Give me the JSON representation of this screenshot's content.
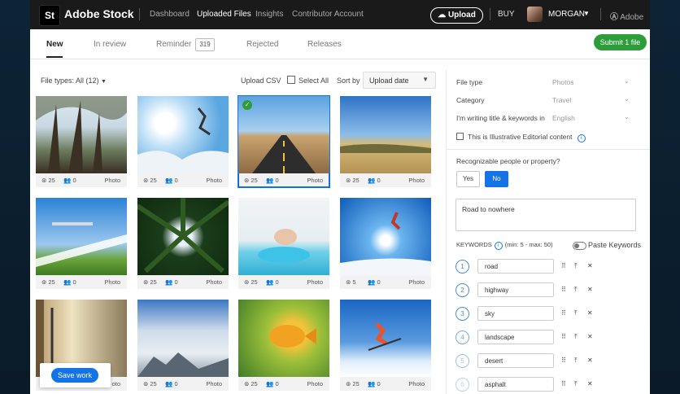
{
  "topbar": {
    "logo": "St",
    "brand": "Adobe Stock",
    "nav": [
      "Dashboard",
      "Uploaded Files",
      "Insights",
      "Contributor Account"
    ],
    "upload": "Upload",
    "buy": "BUY",
    "user": "MORGAN",
    "adobe": "Adobe"
  },
  "tabs": {
    "items": [
      "New",
      "In review",
      "Reminder",
      "Rejected",
      "Releases"
    ],
    "reminder_count": "319",
    "submit": "Submit 1 file"
  },
  "filter": {
    "file_types": "File types: All (12)",
    "upload_csv": "Upload CSV",
    "select_all": "Select All",
    "sort_by": "Sort by",
    "sort_value": "Upload date"
  },
  "cards": [
    {
      "s": "25",
      "c": "0",
      "type": "Photo"
    },
    {
      "s": "25",
      "c": "0",
      "type": "Photo"
    },
    {
      "s": "25",
      "c": "0",
      "type": "Photo"
    },
    {
      "s": "25",
      "c": "0",
      "type": "Photo"
    },
    {
      "s": "25",
      "c": "0",
      "type": "Photo"
    },
    {
      "s": "25",
      "c": "0",
      "type": "Photo"
    },
    {
      "s": "25",
      "c": "0",
      "type": "Photo"
    },
    {
      "s": "5",
      "c": "0",
      "type": "Photo"
    },
    {
      "s": "",
      "c": "",
      "type": "oto"
    },
    {
      "s": "25",
      "c": "0",
      "type": "Photo"
    },
    {
      "s": "25",
      "c": "0",
      "type": "Photo"
    },
    {
      "s": "25",
      "c": "0",
      "type": "Photo"
    }
  ],
  "save_work": "Save work",
  "panel": {
    "file_type_label": "File type",
    "file_type_value": "Photos",
    "category_label": "Category",
    "category_value": "Travel",
    "language_label": "I'm writing title & keywords in",
    "language_value": "English",
    "illustrative": "This is Illustrative Editorial content",
    "people_question": "Recognizable people or property?",
    "yes": "Yes",
    "no": "No",
    "title": "Road to nowhere",
    "keywords_label": "KEYWORDS",
    "keywords_range": "(min: 5 - max: 50)",
    "paste_keywords": "Paste Keywords",
    "keywords": [
      {
        "n": "1",
        "word": "road"
      },
      {
        "n": "2",
        "word": "highway"
      },
      {
        "n": "3",
        "word": "sky"
      },
      {
        "n": "4",
        "word": "landscape"
      },
      {
        "n": "5",
        "word": "desert"
      },
      {
        "n": "6",
        "word": "asphalt"
      }
    ]
  },
  "colors": {
    "accent": "#1473e6",
    "submit": "#2d9d3a",
    "topbar": "#1a1a1a"
  }
}
